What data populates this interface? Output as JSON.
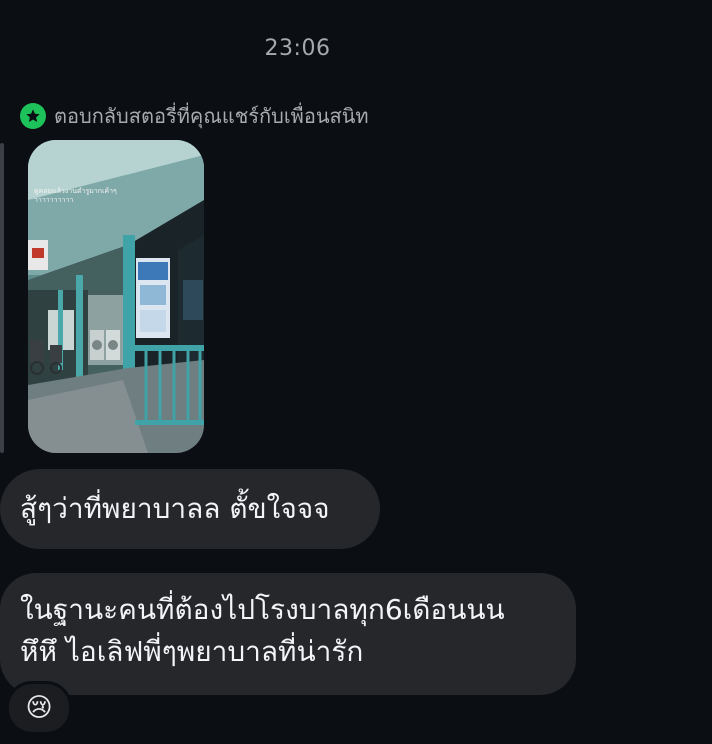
{
  "chat": {
    "timestamp": "23:06",
    "reply_header": {
      "icon": "star-icon",
      "text": "ตอบกลับสตอรี่ที่คุณแชร์กับเพื่อนสนิท",
      "badge_color": "#1ec25b"
    },
    "story": {
      "caption_line1": "ดูคลมแล้วงานตำรูมากเค้าๆ",
      "caption_line2": "าาาาาาาาาา"
    },
    "messages": [
      {
        "text": "สู้ๆว่าที่พยาบาลล ตั้ขใจจจ"
      },
      {
        "line1": "ในฐานะคนที่ต้องไปโรงบาลทุก6เดือนนน",
        "line2": "หึหึ ไอเลิฟพี่ๆพยาบาลที่น่ารัก"
      }
    ],
    "reaction": {
      "emoji": "😢"
    }
  }
}
